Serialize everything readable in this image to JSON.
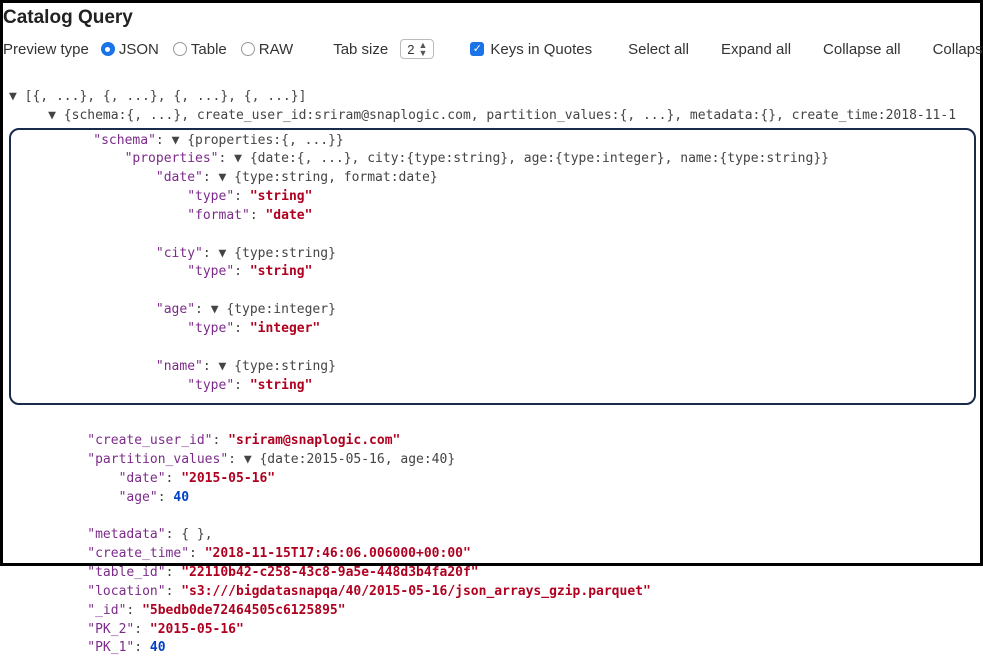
{
  "title": "Catalog Query",
  "toolbar": {
    "preview_label": "Preview type",
    "radios": {
      "json": "JSON",
      "table": "Table",
      "raw": "RAW"
    },
    "selected_radio": "json",
    "tab_size_label": "Tab size",
    "tab_size_value": "2",
    "keys_in_quotes_label": "Keys in Quotes",
    "keys_in_quotes_checked": true,
    "actions": {
      "select_all": "Select all",
      "expand_all": "Expand all",
      "collapse_all": "Collapse all",
      "collapse_trunc": "Collapse"
    }
  },
  "json": {
    "root_summary": "[{, ...}, {, ...}, {, ...}, {, ...}]",
    "item0_summary": "{schema:{, ...}, create_user_id:sriram@snaplogic.com, partition_values:{, ...}, metadata:{}, create_time:2018-11-1",
    "schema_key": "\"schema\"",
    "schema_summary": "{properties:{, ...}}",
    "properties_key": "\"properties\"",
    "properties_summary": "{date:{, ...}, city:{type:string}, age:{type:integer}, name:{type:string}}",
    "date_key": "\"date\"",
    "date_summary": "{type:string, format:date}",
    "type_key": "\"type\"",
    "format_key": "\"format\"",
    "date_type_value": "\"string\"",
    "date_format_value": "\"date\"",
    "city_key": "\"city\"",
    "city_summary": "{type:string}",
    "city_type_value": "\"string\"",
    "age_key": "\"age\"",
    "age_summary": "{type:integer}",
    "age_type_value": "\"integer\"",
    "name_key": "\"name\"",
    "name_summary": "{type:string}",
    "name_type_value": "\"string\"",
    "create_user_id_key": "\"create_user_id\"",
    "create_user_id_value": "\"sriram@snaplogic.com\"",
    "partition_values_key": "\"partition_values\"",
    "partition_values_summary": "{date:2015-05-16, age:40}",
    "pv_date_key": "\"date\"",
    "pv_date_value": "\"2015-05-16\"",
    "pv_age_key": "\"age\"",
    "pv_age_value": "40",
    "metadata_key": "\"metadata\"",
    "metadata_value": "{ },",
    "create_time_key": "\"create_time\"",
    "create_time_value": "\"2018-11-15T17:46:06.006000+00:00\"",
    "table_id_key": "\"table_id\"",
    "table_id_value": "\"22110b42-c258-43c8-9a5e-448d3b4fa20f\"",
    "location_key": "\"location\"",
    "location_value": "\"s3:///bigdatasnapqa/40/2015-05-16/json_arrays_gzip.parquet\"",
    "id_key": "\"_id\"",
    "id_value": "\"5bedb0de72464505c6125895\"",
    "pk2_key": "\"PK_2\"",
    "pk2_value": "\"2015-05-16\"",
    "pk1_key": "\"PK_1\"",
    "pk1_value": "40"
  }
}
